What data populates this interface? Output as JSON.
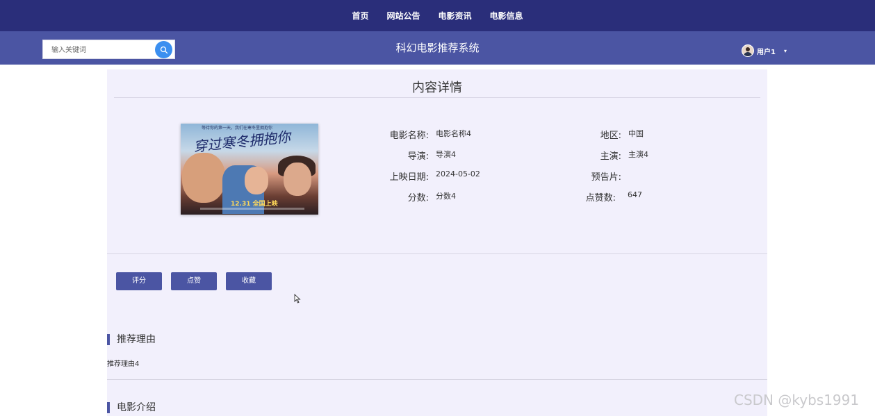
{
  "nav": {
    "items": [
      {
        "label": "首页"
      },
      {
        "label": "网站公告"
      },
      {
        "label": "电影资讯"
      },
      {
        "label": "电影信息"
      }
    ]
  },
  "header": {
    "search_placeholder": "输入关键词",
    "site_title": "科幻电影推荐系统",
    "user_name": "用户1",
    "caret": "▾"
  },
  "detail": {
    "page_title": "内容详情",
    "poster": {
      "title_text": "穿过寒冬拥抱你",
      "tagline": "等待你的第一天，我们在寒冬里拥抱你",
      "release_text": "12.31 全国上映"
    },
    "fields": {
      "name_label": "电影名称:",
      "name_value": "电影名称4",
      "region_label": "地区:",
      "region_value": "中国",
      "director_label": "导演:",
      "director_value": "导演4",
      "star_label": "主演:",
      "star_value": "主演4",
      "date_label": "上映日期:",
      "date_value": "2024-05-02",
      "trailer_label": "预告片:",
      "trailer_value": "",
      "score_label": "分数:",
      "score_value": "分数4",
      "likes_label": "点赞数:",
      "likes_value": "647"
    },
    "actions": {
      "rate_label": "评分",
      "like_label": "点赞",
      "collect_label": "收藏"
    },
    "sections": {
      "reason_title": "推荐理由",
      "reason_text": "推荐理由4",
      "intro_title": "电影介绍"
    }
  },
  "watermark": "CSDN @kybs1991",
  "colors": {
    "topnav_bg": "#2a2e7a",
    "subbar_bg": "#4b55a3",
    "content_bg": "#f2f0fc",
    "button_bg": "#4b55a3",
    "search_button": "#3b8ff0"
  }
}
